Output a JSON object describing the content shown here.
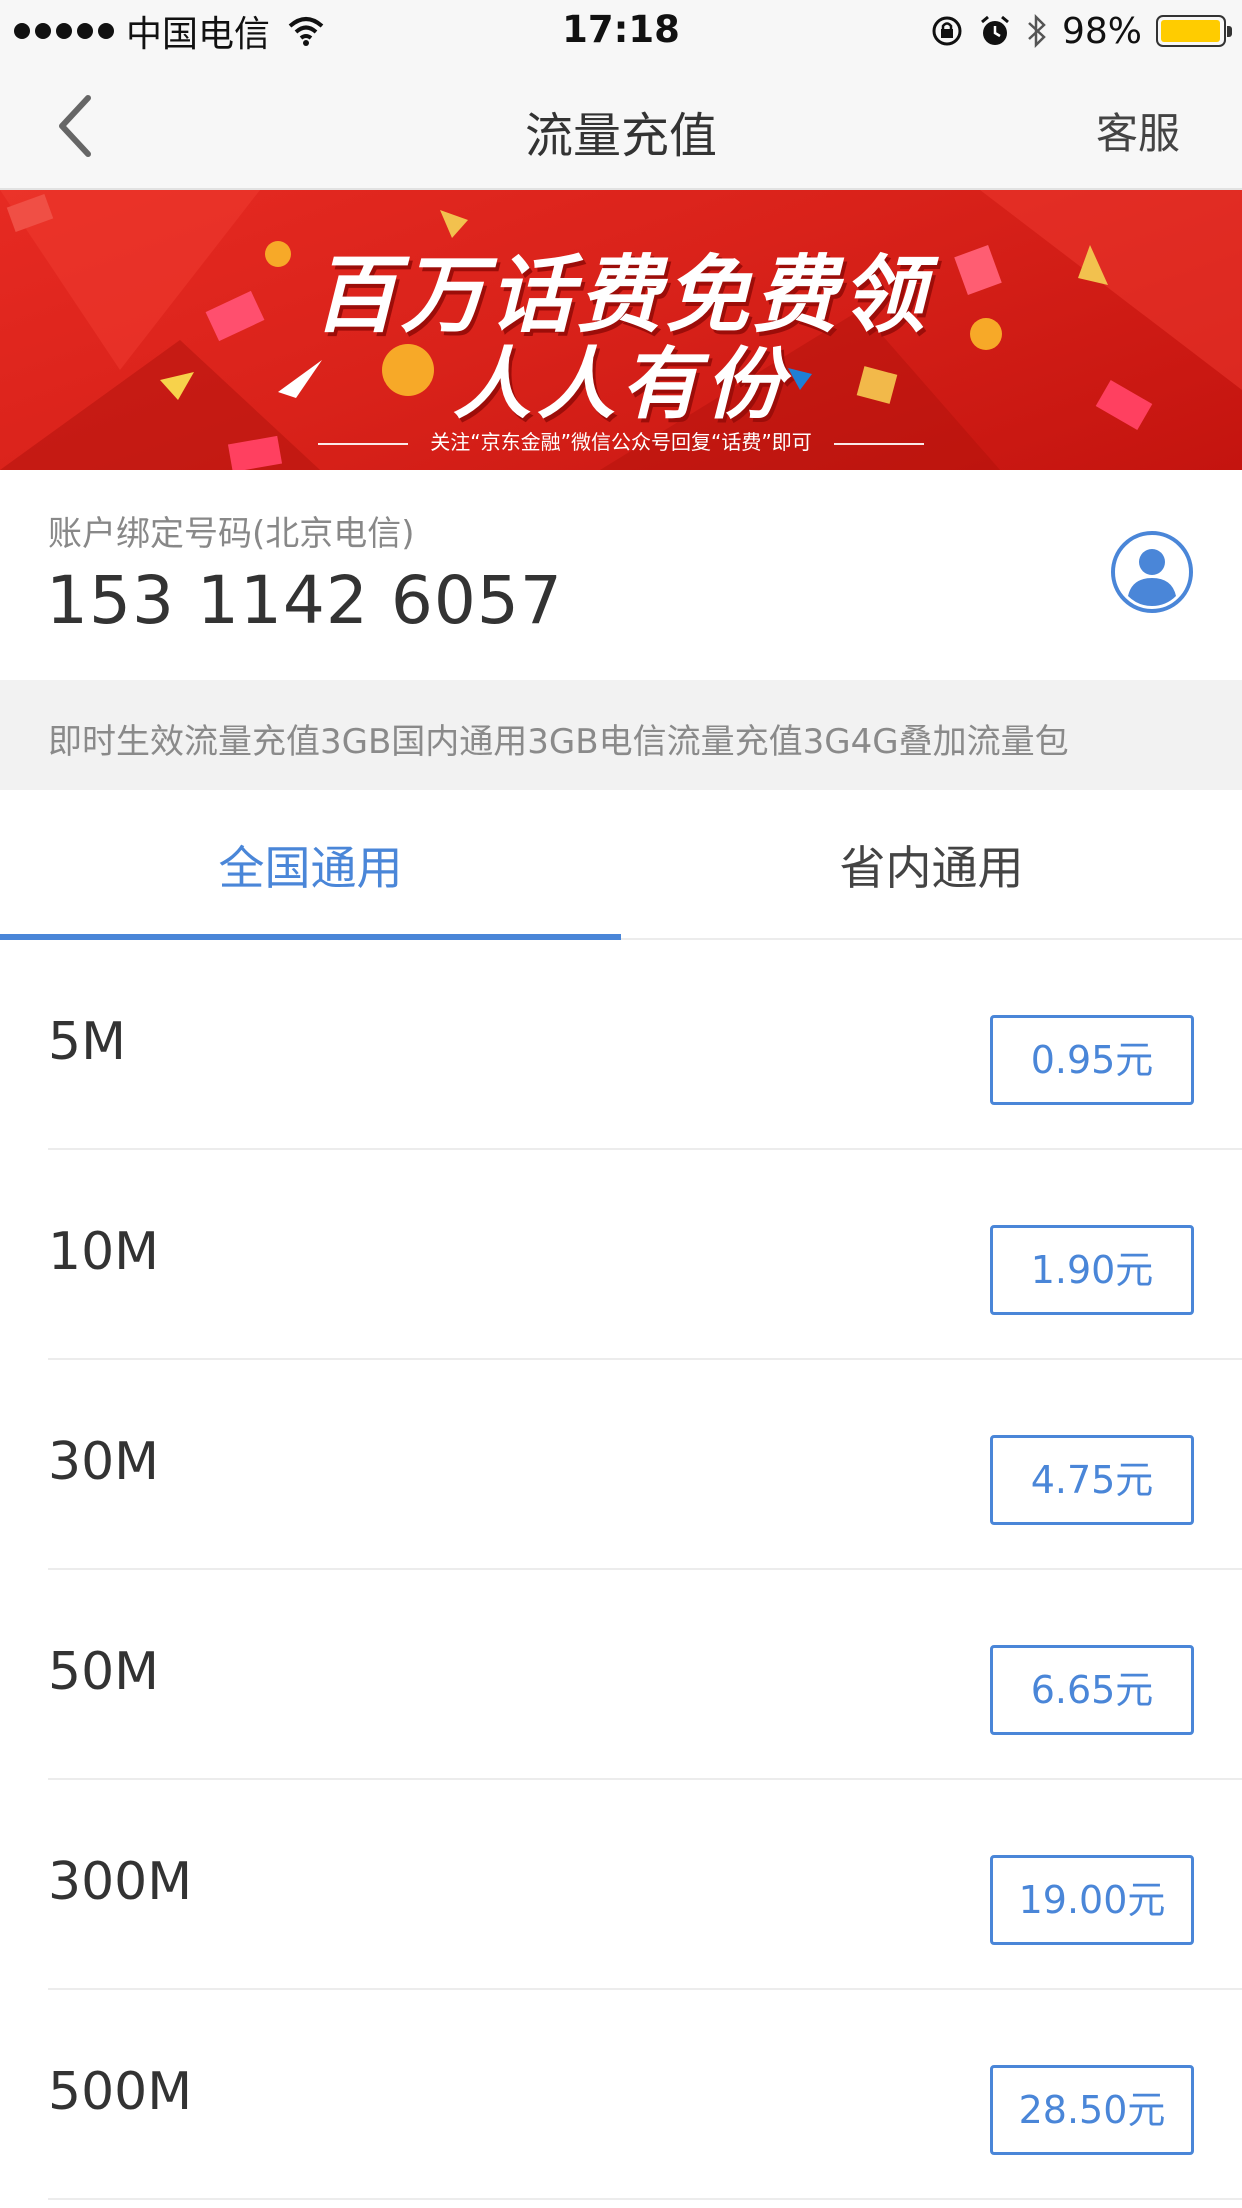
{
  "status_bar": {
    "carrier": "中国电信",
    "time": "17:18",
    "battery_percent_text": "98%",
    "battery_level": 0.98,
    "icons": [
      "signal-dots-icon",
      "wifi-icon",
      "rotation-lock-icon",
      "alarm-icon",
      "bluetooth-icon",
      "battery-icon"
    ]
  },
  "nav": {
    "back_icon": "chevron-left-icon",
    "title": "流量充值",
    "service_label": "客服"
  },
  "banner": {
    "line1": "百万话费免费领",
    "line2": "人人有份",
    "caption": "关注“京东金融”微信公众号回复“话费”即可"
  },
  "account": {
    "label": "账户绑定号码(北京电信)",
    "number": "153 1142 6057",
    "contact_icon": "contact-person-icon"
  },
  "notice": {
    "text": "即时生效流量充值3GB国内通用3GB电信流量充值3G4G叠加流量包"
  },
  "tabs": {
    "items": [
      {
        "label": "全国通用",
        "active": true
      },
      {
        "label": "省内通用",
        "active": false
      }
    ]
  },
  "plans": [
    {
      "size": "5M",
      "price": "0.95元"
    },
    {
      "size": "10M",
      "price": "1.90元"
    },
    {
      "size": "30M",
      "price": "4.75元"
    },
    {
      "size": "50M",
      "price": "6.65元"
    },
    {
      "size": "300M",
      "price": "19.00元"
    },
    {
      "size": "500M",
      "price": "28.50元"
    }
  ],
  "colors": {
    "accent": "#4a86d8",
    "banner_red": "#d9221a",
    "battery": "#ffcc00"
  }
}
